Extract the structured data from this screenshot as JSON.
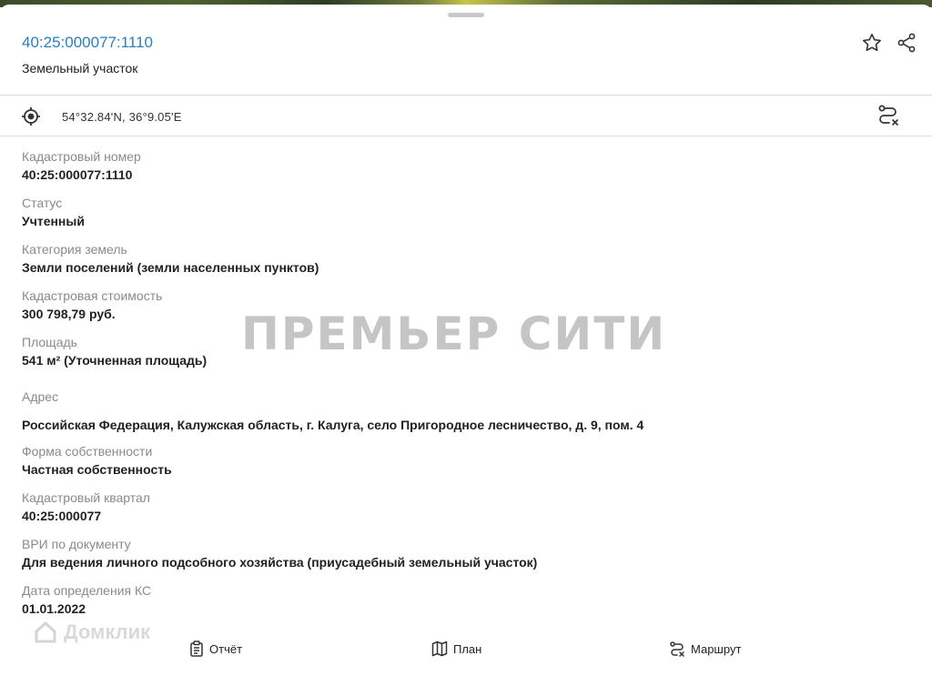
{
  "header": {
    "title": "40:25:000077:1110",
    "subtitle": "Земельный участок",
    "star_icon": "star-icon",
    "share_icon": "share-icon"
  },
  "coords": {
    "text": "54°32.84'N, 36°9.05'E",
    "locate_icon": "crosshair-icon",
    "route_icon": "route-cancel-icon"
  },
  "fields": [
    {
      "label": "Кадастровый номер",
      "value": "40:25:000077:1110"
    },
    {
      "label": "Статус",
      "value": "Учтенный"
    },
    {
      "label": "Категория земель",
      "value": "Земли поселений (земли населенных пунктов)"
    },
    {
      "label": "Кадастровая стоимость",
      "value": "300 798,79 руб."
    },
    {
      "label": "Площадь",
      "value": "541 м² (Уточненная площадь)"
    },
    {
      "label": "Адрес",
      "value": "Российская Федерация, Калужская область, г. Калуга, село Пригородное лесничество, д. 9, пом. 4"
    },
    {
      "label": "Форма собственности",
      "value": "Частная собственность"
    },
    {
      "label": "Кадастровый квартал",
      "value": "40:25:000077"
    },
    {
      "label": "ВРИ по документу",
      "value": "Для ведения личного подсобного хозяйства (приусадебный земельный участок)"
    },
    {
      "label": "Дата определения КС",
      "value": "01.01.2022"
    }
  ],
  "watermark": "ПРЕМЬЕР СИТИ",
  "logo_watermark": "Домклик",
  "bottom_tabs": [
    {
      "label": "Отчёт",
      "icon": "clipboard-icon"
    },
    {
      "label": "План",
      "icon": "map-icon"
    },
    {
      "label": "Маршрут",
      "icon": "route-icon"
    }
  ]
}
